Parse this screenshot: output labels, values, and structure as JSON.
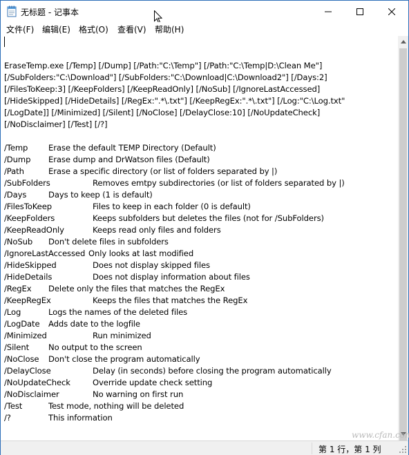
{
  "window": {
    "title": "无标题 - 记事本"
  },
  "menu": [
    {
      "label": "文件(F)"
    },
    {
      "label": "编辑(E)"
    },
    {
      "label": "格式(O)"
    },
    {
      "label": "查看(V)"
    },
    {
      "label": "帮助(H)"
    }
  ],
  "editor": {
    "usage_lines": [
      "EraseTemp.exe [/Temp] [/Dump] [/Path:\"C:\\Temp\"] [/Path:\"C:\\Temp|D:\\Clean Me\"]",
      "[/SubFolders:\"C:\\Download\"] [/SubFolders:\"C:\\Download|C:\\Download2\"] [/Days:2]",
      "[/FilesToKeep:3] [/KeepFolders] [/KeepReadOnly] [/NoSub] [/IgnoreLastAccessed]",
      "[/HideSkipped] [/HideDetails] [/RegEx:\".*\\.txt\"] [/KeepRegEx:\".*\\.txt\"] [/Log:\"C:\\Log.txt\"",
      "[/LogDate]] [/Minimized] [/Silent] [/NoClose] [/DelayClose:10] [/NoUpdateCheck]",
      "[/NoDisclaimer] [/Test] [/?]"
    ],
    "options": [
      {
        "name": "/Temp",
        "desc": "Erase the default TEMP Directory (Default)",
        "col": 1
      },
      {
        "name": "/Dump",
        "desc": "Erase dump and DrWatson files (Default)",
        "col": 1
      },
      {
        "name": "/Path",
        "desc": "Erase a specific directory (or list of folders separated by |)",
        "col": 1
      },
      {
        "name": "/SubFolders",
        "desc": "Removes emtpy subdirectories (or list of folders separated by |)",
        "col": 2
      },
      {
        "name": "/Days",
        "desc": "Days to keep (1 is default)",
        "col": 1
      },
      {
        "name": "/FilesToKeep",
        "desc": "Files to keep in each folder (0 is default)",
        "col": 2
      },
      {
        "name": "/KeepFolders",
        "desc": "Keeps subfolders but deletes the files (not for /SubFolders)",
        "col": 2
      },
      {
        "name": "/KeepReadOnly",
        "desc": "Keeps read only files and folders",
        "col": 2
      },
      {
        "name": "/NoSub",
        "desc": "Don't delete files in subfolders",
        "col": 1
      },
      {
        "name": "/IgnoreLastAccessed",
        "desc": "Only looks at last modified",
        "col": 3
      },
      {
        "name": "/HideSkipped",
        "desc": "Does not display skipped files",
        "col": 2
      },
      {
        "name": "/HideDetails",
        "desc": "Does not display information about files",
        "col": 2
      },
      {
        "name": "/RegEx",
        "desc": "Delete only the files that matches the RegEx",
        "col": 1
      },
      {
        "name": "/KeepRegEx",
        "desc": "Keeps the files that matches the RegEx",
        "col": 2
      },
      {
        "name": "/Log",
        "desc": "Logs the names of the deleted files",
        "col": 1
      },
      {
        "name": "/LogDate",
        "desc": "Adds date to the logfile",
        "col": 1
      },
      {
        "name": "/Minimized",
        "desc": "Run minimized",
        "col": 2
      },
      {
        "name": "/Silent",
        "desc": "No output to the screen",
        "col": 1
      },
      {
        "name": "/NoClose",
        "desc": "Don't close the program automatically",
        "col": 1
      },
      {
        "name": "/DelayClose",
        "desc": "Delay (in seconds) before closing the program automatically",
        "col": 2
      },
      {
        "name": "/NoUpdateCheck",
        "desc": "Override update check setting",
        "col": 2
      },
      {
        "name": "/NoDisclaimer",
        "desc": "No warning on first run",
        "col": 2
      },
      {
        "name": "/Test",
        "desc": "Test mode, nothing will be deleted",
        "col": 1
      },
      {
        "name": "/?",
        "desc": "This information",
        "col": 1
      }
    ]
  },
  "status": {
    "position": "第 1 行，第 1 列"
  },
  "watermark": "www.cfan.com.cn",
  "icons": {
    "app": "notepad-icon",
    "minimize": "minimize-icon",
    "maximize": "maximize-icon",
    "close": "close-icon"
  }
}
